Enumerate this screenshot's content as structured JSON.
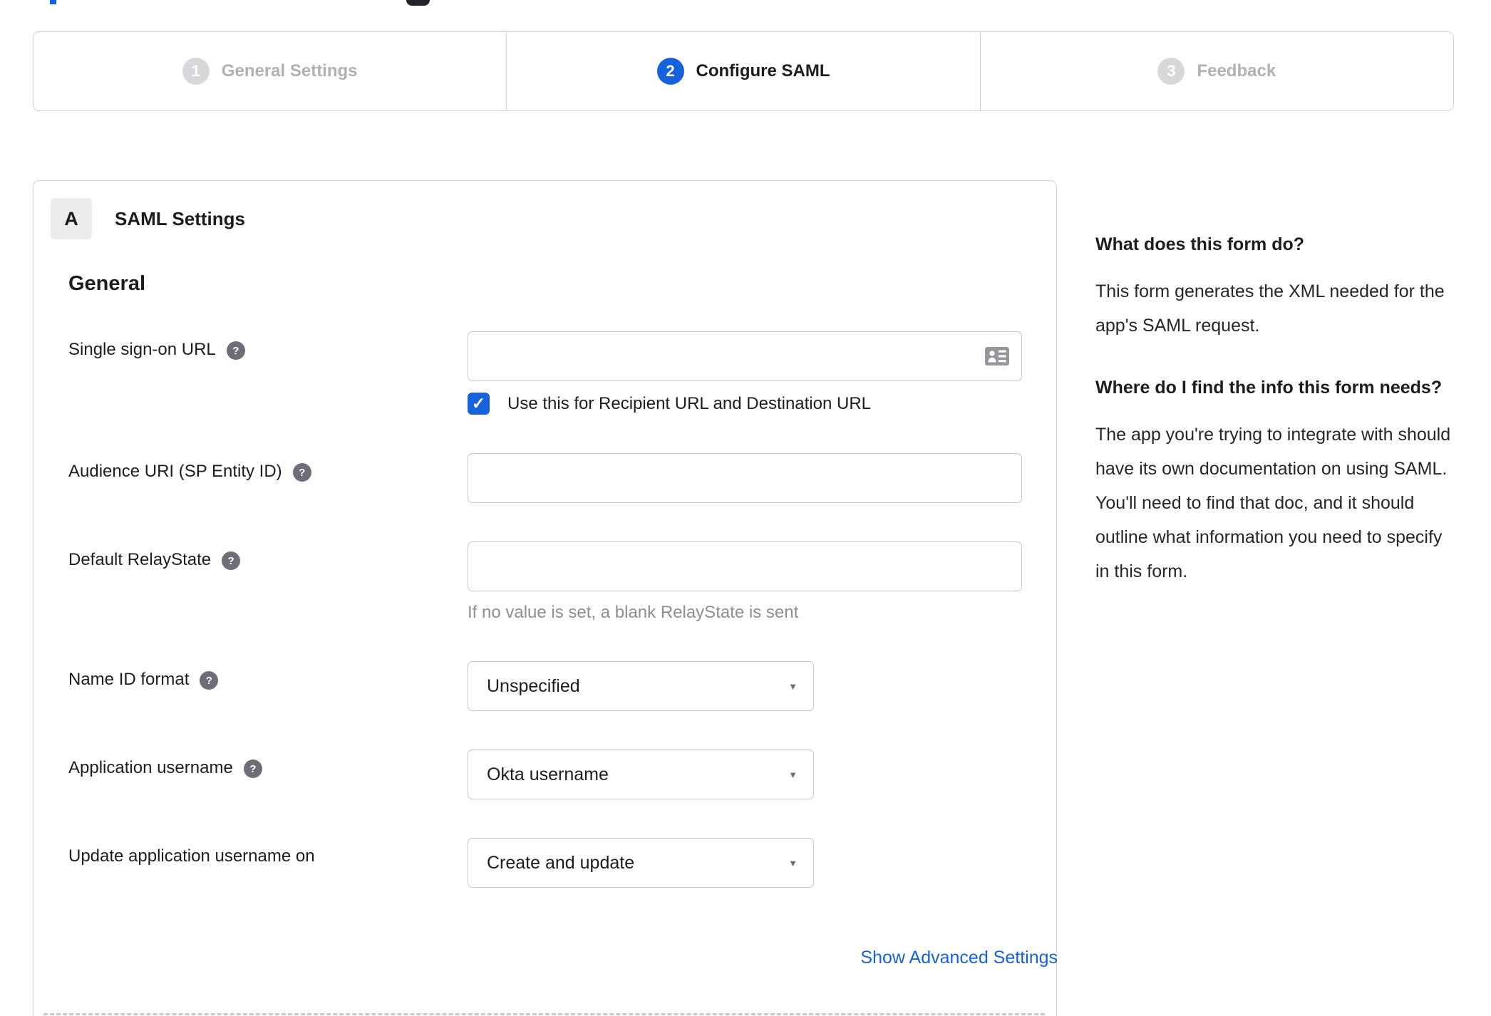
{
  "colors": {
    "accent_blue": "#1662dd",
    "dark_text": "#1d1d21",
    "inactive_gray": "#b0b0b5",
    "border_gray": "#d2d2d6",
    "hint_gray": "#8e8e93"
  },
  "icons": {
    "help_glyph": "?",
    "check_glyph": "✓",
    "caret_glyph": "▼"
  },
  "stepper": {
    "steps": [
      {
        "number": "1",
        "label": "General Settings",
        "state": "inactive"
      },
      {
        "number": "2",
        "label": "Configure SAML",
        "state": "active"
      },
      {
        "number": "3",
        "label": "Feedback",
        "state": "inactive"
      }
    ]
  },
  "panel": {
    "section_badge": "A",
    "section_title": "SAML Settings",
    "group_heading": "General",
    "fields": [
      {
        "label": "Single sign-on URL",
        "type": "text",
        "value": "",
        "placeholder": "",
        "has_help": true,
        "trailing_icon": "contact-card-icon",
        "checkbox": {
          "checked": true,
          "label": "Use this for Recipient URL and Destination URL"
        }
      },
      {
        "label": "Audience URI (SP Entity ID)",
        "type": "text",
        "value": "",
        "placeholder": "",
        "has_help": true
      },
      {
        "label": "Default RelayState",
        "type": "text",
        "value": "",
        "placeholder": "",
        "has_help": true,
        "hint": "If no value is set, a blank RelayState is sent"
      },
      {
        "label": "Name ID format",
        "type": "select",
        "value": "Unspecified",
        "has_help": true
      },
      {
        "label": "Application username",
        "type": "select",
        "value": "Okta username",
        "has_help": true
      },
      {
        "label": "Update application username on",
        "type": "select",
        "value": "Create and update",
        "has_help": false
      }
    ],
    "advanced_link": "Show Advanced Settings"
  },
  "sidebar": {
    "blocks": [
      {
        "heading": "What does this form do?",
        "body": "This form generates the XML needed for the app's SAML request."
      },
      {
        "heading": "Where do I find the info this form needs?",
        "body": "The app you're trying to integrate with should have its own documentation on using SAML. You'll need to find that doc, and it should outline what information you need to specify in this form."
      }
    ]
  }
}
